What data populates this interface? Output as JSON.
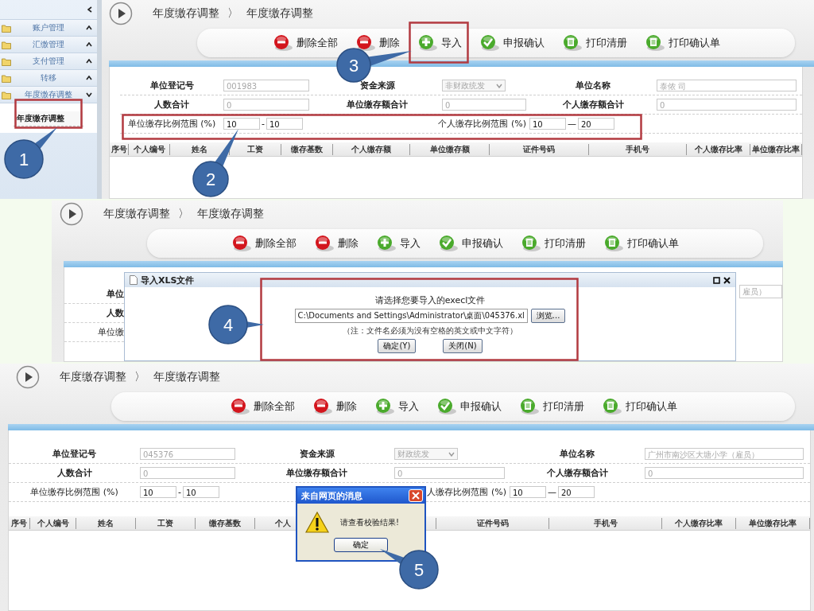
{
  "panels": [
    {
      "kind": "full",
      "sidebar": {
        "items": [
          {
            "label": "账户管理",
            "expanded": false
          },
          {
            "label": "汇缴管理",
            "expanded": false
          },
          {
            "label": "支付管理",
            "expanded": false
          },
          {
            "label": "转移",
            "expanded": false
          },
          {
            "label": "年度缴存调整",
            "expanded": true,
            "children": [
              {
                "label": "年度缴存调整",
                "selected": true
              }
            ]
          }
        ]
      },
      "breadcrumb": {
        "items": [
          "年度缴存调整",
          "年度缴存调整"
        ],
        "separator": "〉"
      },
      "toolbar": [
        {
          "label": "删除全部",
          "kind": "remove"
        },
        {
          "label": "删除",
          "kind": "remove"
        },
        {
          "label": "导入",
          "kind": "add"
        },
        {
          "label": "申报确认",
          "kind": "check"
        },
        {
          "label": "打印清册",
          "kind": "print"
        },
        {
          "label": "打印确认单",
          "kind": "print"
        }
      ],
      "form": [
        [
          {
            "label": "单位登记号",
            "value": "001983",
            "disabled": true
          },
          {
            "label": "资金来源",
            "value": "非财政统发",
            "kind": "select",
            "disabled": true
          },
          {
            "label": "单位名称",
            "value": "泰侬          司",
            "disabled": true
          }
        ],
        [
          {
            "label": "人数合计",
            "value": "0",
            "disabled": true
          },
          {
            "label": "单位缴存额合计",
            "value": "0",
            "disabled": true
          },
          {
            "label": "个人缴存额合计",
            "value": "0",
            "disabled": true
          }
        ],
        [
          {
            "label": "单位缴存比例范围 (%)",
            "kind": "range",
            "from": "10",
            "separator": "-",
            "to": "10"
          },
          {
            "label": "个人缴存比例范围 (%)",
            "kind": "range",
            "from": "10",
            "separator": "—",
            "to": "20"
          }
        ]
      ],
      "table": {
        "columns": [
          "序号",
          "个人编号",
          "姓名",
          "工资",
          "缴存基数",
          "个人缴存额",
          "单位缴存额",
          "证件号码",
          "手机号",
          "个人缴存比率",
          "单位缴存比率"
        ]
      }
    },
    {
      "kind": "dialog",
      "breadcrumb": {
        "items": [
          "年度缴存调整",
          "年度缴存调整"
        ],
        "separator": "〉"
      },
      "toolbar": [
        {
          "label": "删除全部",
          "kind": "remove"
        },
        {
          "label": "删除",
          "kind": "remove"
        },
        {
          "label": "导入",
          "kind": "add"
        },
        {
          "label": "申报确认",
          "kind": "check"
        },
        {
          "label": "打印清册",
          "kind": "print"
        },
        {
          "label": "打印确认单",
          "kind": "print"
        }
      ],
      "covered_labels": [
        "单位",
        "人数",
        "单位缴"
      ],
      "covered_value": "雇员）",
      "dialog": {
        "title": "导入XLS文件",
        "prompt": "请选择您要导入的execl文件",
        "file": "C:\\Documents and Settings\\Administrator\\桌面\\045376.xl",
        "browse": "浏览...",
        "note": "（注：文件名必须为没有空格的英文或中文字符）",
        "buttons": [
          "确定(Y)",
          "关闭(N)"
        ]
      }
    },
    {
      "kind": "message",
      "breadcrumb": {
        "items": [
          "年度缴存调整",
          "年度缴存调整"
        ],
        "separator": "〉"
      },
      "toolbar": [
        {
          "label": "删除全部",
          "kind": "remove"
        },
        {
          "label": "删除",
          "kind": "remove"
        },
        {
          "label": "导入",
          "kind": "add"
        },
        {
          "label": "申报确认",
          "kind": "check"
        },
        {
          "label": "打印清册",
          "kind": "print"
        },
        {
          "label": "打印确认单",
          "kind": "print"
        }
      ],
      "form": [
        [
          {
            "label": "单位登记号",
            "value": "045376",
            "disabled": true
          },
          {
            "label": "资金来源",
            "value": "财政统发",
            "kind": "select",
            "disabled": true
          },
          {
            "label": "单位名称",
            "value": "广州市南沙区大塘小学（雇员）",
            "disabled": true
          }
        ],
        [
          {
            "label": "人数合计",
            "value": "0",
            "disabled": true
          },
          {
            "label": "单位缴存额合计",
            "value": "0",
            "disabled": true
          },
          {
            "label": "个人缴存额合计",
            "value": "0",
            "disabled": true
          }
        ],
        [
          {
            "label": "单位缴存比例范围 (%)",
            "kind": "range",
            "from": "10",
            "separator": "-",
            "to": "10"
          },
          {
            "label": "人缴存比例范围 (%)",
            "kind": "range",
            "from": "10",
            "separator": "—",
            "to": "20"
          }
        ]
      ],
      "table": {
        "columns": [
          "序号",
          "个人编号",
          "姓名",
          "工资",
          "缴存基数",
          "个人",
          "证件号码",
          "手机号",
          "个人缴存比率",
          "单位缴存比率"
        ]
      },
      "message": {
        "title": "来自网页的消息",
        "text": "请查看校验结果!",
        "button": "确定"
      }
    }
  ],
  "callouts": [
    {
      "number": "1",
      "highlight": true
    },
    {
      "number": "2",
      "highlight": true
    },
    {
      "number": "3",
      "highlight": true
    },
    {
      "number": "4",
      "highlight": true
    },
    {
      "number": "5",
      "highlight": false
    }
  ]
}
